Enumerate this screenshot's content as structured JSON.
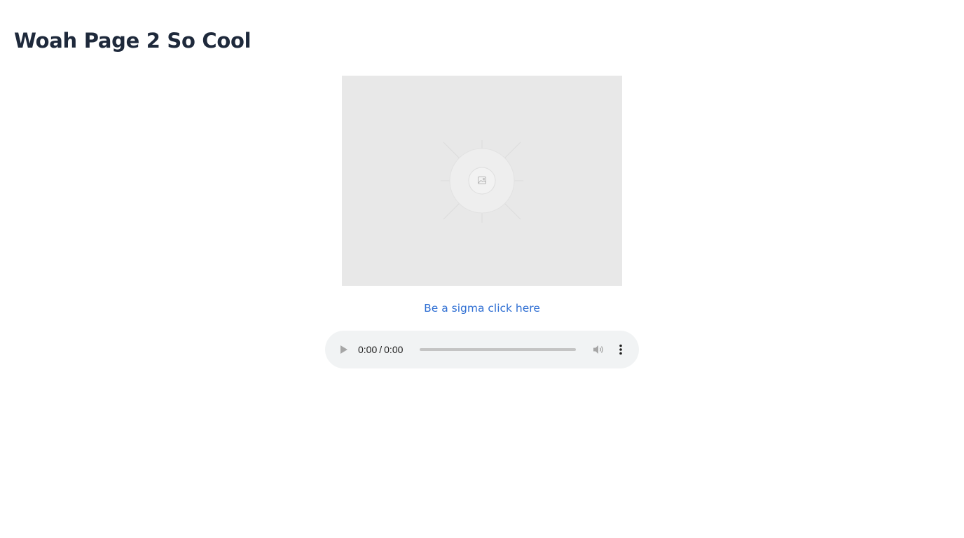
{
  "page": {
    "title": "Woah Page 2 So Cool"
  },
  "image": {
    "icon": "image-placeholder-icon",
    "background_color": "#e8e8e8"
  },
  "link": {
    "text": "Be a sigma click here",
    "color": "#2f6fd3"
  },
  "audio": {
    "current_time": "0:00",
    "separator": "/",
    "duration": "0:00",
    "progress": 0,
    "play_icon": "play-icon",
    "volume_icon": "volume-icon",
    "menu_icon": "more-vertical-icon",
    "background_color": "#f1f3f4"
  }
}
